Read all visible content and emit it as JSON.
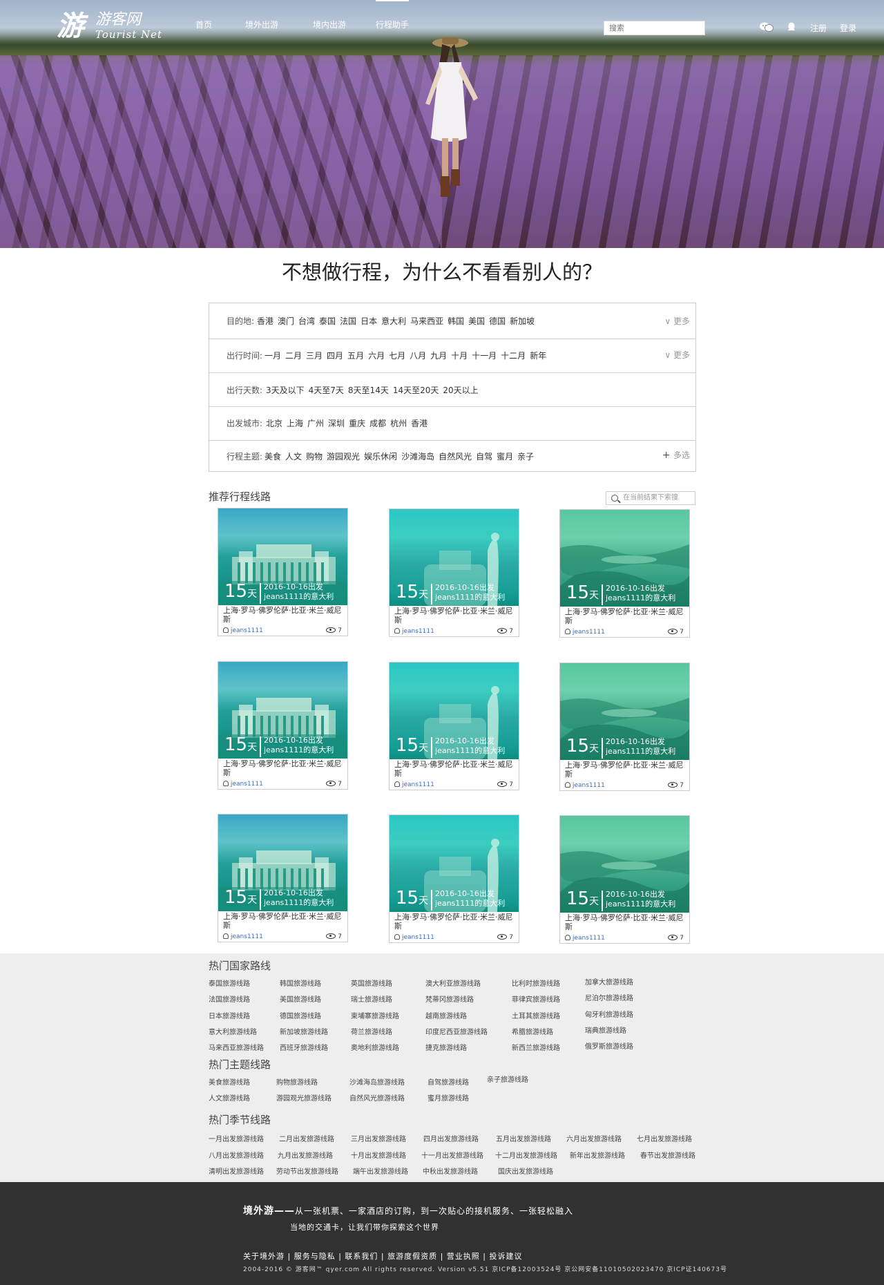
{
  "nav": {
    "logo_glyph": "游",
    "logo_cn": "游客网",
    "logo_en": "Tourist Net",
    "items": [
      "首页",
      "境外出游",
      "境内出游",
      "行程助手"
    ],
    "search_placeholder": "搜索",
    "register": "注册",
    "login": "登录"
  },
  "headline": "不想做行程，为什么不看看别人的？",
  "filters": {
    "destination": {
      "label": "目的地:",
      "items": [
        "香港",
        "澳门",
        "台湾",
        "泰国",
        "法国",
        "日本",
        "意大利",
        "马来西亚",
        "韩国",
        "美国",
        "德国",
        "新加坡"
      ],
      "more": "更多"
    },
    "time": {
      "label": "出行时间:",
      "items": [
        "一月",
        "二月",
        "三月",
        "四月",
        "五月",
        "六月",
        "七月",
        "八月",
        "九月",
        "十月",
        "十一月",
        "十二月",
        "新年"
      ],
      "more": "更多"
    },
    "days": {
      "label": "出行天数:",
      "items": [
        "3天及以下",
        "4天至7天",
        "8天至14天",
        "14天至20天",
        "20天以上"
      ]
    },
    "city": {
      "label": "出发城市:",
      "items": [
        "北京",
        "上海",
        "广州",
        "深圳",
        "重庆",
        "成都",
        "杭州",
        "香港"
      ]
    },
    "theme": {
      "label": "行程主题:",
      "items": [
        "美食",
        "人文",
        "购物",
        "游园观光",
        "娱乐休闲",
        "沙滩海岛",
        "自然风光",
        "自驾",
        "蜜月",
        "亲子"
      ],
      "more": "多选"
    }
  },
  "recommend": {
    "title": "推荐行程线路",
    "search_placeholder": "在当前结果下索搜"
  },
  "cards": [
    {
      "days": "15",
      "unit": "天",
      "date": "2016-10-16出发",
      "author_line": "jeans1111的意大利",
      "route": "上海·罗马·佛罗伦萨·比亚·米兰·威尼斯",
      "user": "jeans1111",
      "views": "7",
      "theme": "a"
    },
    {
      "days": "15",
      "unit": "天",
      "date": "2016-10-16出发",
      "author_line": "jeans1111的意大利",
      "route": "上海·罗马·佛罗伦萨·比亚·米兰·威尼斯",
      "user": "jeans1111",
      "views": "7",
      "theme": "b"
    },
    {
      "days": "15",
      "unit": "天",
      "date": "2016-10-16出发",
      "author_line": "jeans1111的意大利",
      "route": "上海·罗马·佛罗伦萨·比亚·米兰·威尼斯",
      "user": "jeans1111",
      "views": "7",
      "theme": "c"
    },
    {
      "days": "15",
      "unit": "天",
      "date": "2016-10-16出发",
      "author_line": "jeans1111的意大利",
      "route": "上海·罗马·佛罗伦萨·比亚·米兰·威尼斯",
      "user": "jeans1111",
      "views": "7",
      "theme": "a"
    },
    {
      "days": "15",
      "unit": "天",
      "date": "2016-10-16出发",
      "author_line": "jeans1111的意大利",
      "route": "上海·罗马·佛罗伦萨·比亚·米兰·威尼斯",
      "user": "jeans1111",
      "views": "7",
      "theme": "b"
    },
    {
      "days": "15",
      "unit": "天",
      "date": "2016-10-16出发",
      "author_line": "jeans1111的意大利",
      "route": "上海·罗马·佛罗伦萨·比亚·米兰·威尼斯",
      "user": "jeans1111",
      "views": "7",
      "theme": "c"
    },
    {
      "days": "15",
      "unit": "天",
      "date": "2016-10-16出发",
      "author_line": "jeans1111的意大利",
      "route": "上海·罗马·佛罗伦萨·比亚·米兰·威尼斯",
      "user": "jeans1111",
      "views": "7",
      "theme": "a"
    },
    {
      "days": "15",
      "unit": "天",
      "date": "2016-10-16出发",
      "author_line": "jeans1111的意大利",
      "route": "上海·罗马·佛罗伦萨·比亚·米兰·威尼斯",
      "user": "jeans1111",
      "views": "7",
      "theme": "b"
    },
    {
      "days": "15",
      "unit": "天",
      "date": "2016-10-16出发",
      "author_line": "jeans1111的意大利",
      "route": "上海·罗马·佛罗伦萨·比亚·米兰·威尼斯",
      "user": "jeans1111",
      "views": "7",
      "theme": "c"
    }
  ],
  "links": {
    "country_title": "热门国家路线",
    "country_cols": [
      [
        "泰国旅游线路",
        "法国旅游线路",
        "日本旅游线路",
        "意大利旅游线路",
        "马来西亚旅游线路"
      ],
      [
        "韩国旅游线路",
        "美国旅游线路",
        "德国旅游线路",
        "新加坡旅游线路",
        "西班牙旅游线路"
      ],
      [
        "英国旅游线路",
        "瑞士旅游线路",
        "柬埔寨旅游线路",
        "荷兰旅游线路",
        "奥地利旅游线路"
      ],
      [
        "澳大利亚旅游线路",
        "梵蒂冈旅游线路",
        "越南旅游线路",
        "印度尼西亚旅游线路",
        "捷克旅游线路"
      ],
      [
        "比利时旅游线路",
        "菲律宾旅游线路",
        "土耳其旅游线路",
        "希腊旅游线路",
        "新西兰旅游线路"
      ],
      [
        "加拿大旅游线路",
        "尼泊尔旅游线路",
        "匈牙利旅游线路",
        "瑞典旅游线路",
        "俄罗斯旅游线路"
      ]
    ],
    "theme_title": "热门主题线路",
    "theme_cols": [
      [
        "美食旅游线路",
        "人文旅游线路"
      ],
      [
        "购物旅游线路",
        "游园观光旅游线路"
      ],
      [
        "沙滩海岛旅游线路",
        "自然风光旅游线路"
      ],
      [
        "自驾旅游线路",
        "蜜月旅游线路"
      ],
      [
        "亲子旅游线路"
      ]
    ],
    "season_title": "热门季节线路",
    "season_rows": [
      [
        "一月出发旅游线路",
        "二月出发旅游线路",
        "三月出发旅游线路",
        "四月出发旅游线路",
        "五月出发旅游线路",
        "六月出发旅游线路",
        "七月出发旅游线路"
      ],
      [
        "八月出发旅游线路",
        "九月出发旅游线路",
        "十月出发旅游线路",
        "十一月出发旅游线路",
        "十二月出发旅游线路",
        "新年出发旅游线路",
        "春节出发旅游线路"
      ],
      [
        "清明出发旅游线路",
        "劳动节出发旅游线路",
        "端午出发旅游线路",
        "中秋出发旅游线路",
        "国庆出发旅游线路"
      ]
    ]
  },
  "footer": {
    "slogan_bold": "境外游——",
    "slogan_rest": "从一张机票、一家酒店的订购，到一次贴心的接机服务、一张轻松融入",
    "slogan_line2": "当地的交通卡，让我们带你探索这个世界",
    "links": "关于境外游 | 服务与隐私 | 联系我们 | 旅游度假资质 | 营业执照 | 投诉建议",
    "copyright": "2004-2016 © 游客网™ qyer.com All rights reserved. Version v5.51 京ICP备12003524号 京公网安备11010502023470 京ICP证140673号"
  }
}
